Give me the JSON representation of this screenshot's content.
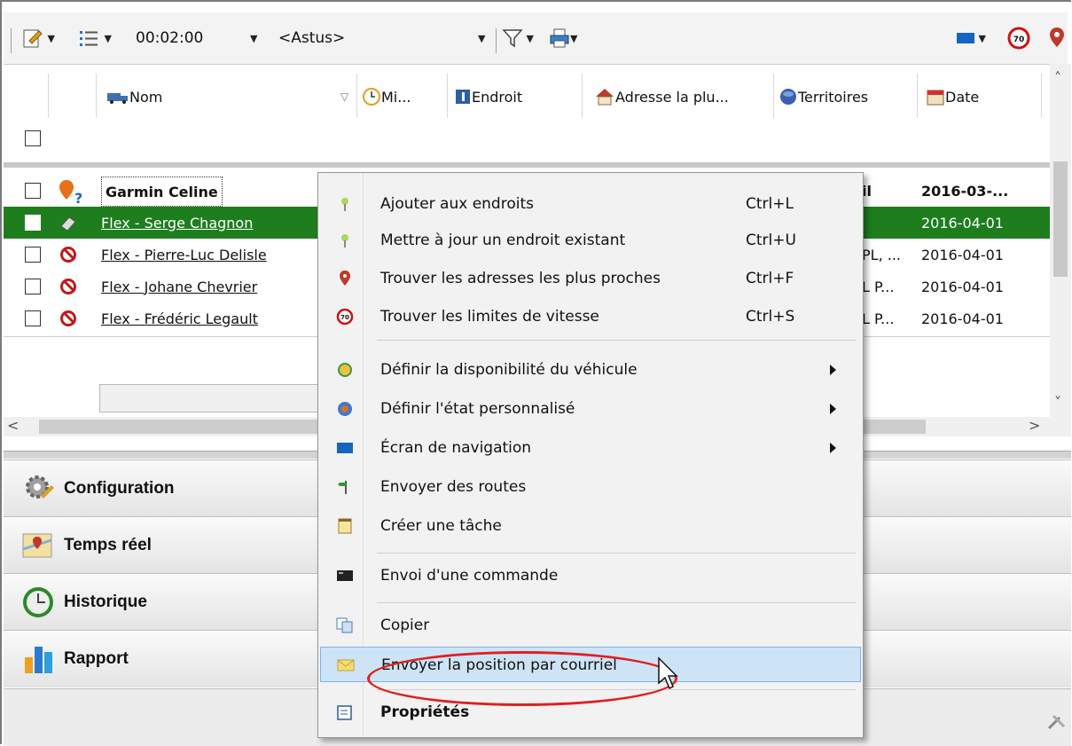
{
  "toolbar": {
    "interval": "00:02:00",
    "view_select": "<Astus>",
    "colors": {
      "bg": "#f3f3f3"
    }
  },
  "grid": {
    "columns": [
      "Nom",
      "Mi...",
      "Endroit",
      "Adresse la plu...",
      "Territoires",
      "Date"
    ],
    "rows": [
      {
        "name": "Garmin Celine",
        "address_cut": "il",
        "date": "2016-03-..."
      },
      {
        "name": "Flex - Serge Chagnon",
        "address_cut": "",
        "date": "2016-04-01"
      },
      {
        "name": "Flex - Pierre-Luc Delisle",
        "address_cut": "PL, ...",
        "date": "2016-04-01"
      },
      {
        "name": "Flex - Johane Chevrier",
        "address_cut": "L P...",
        "date": "2016-04-01"
      },
      {
        "name": "Flex - Frédéric Legault",
        "address_cut": "L P...",
        "date": "2016-04-01"
      }
    ],
    "selected_color": "#1e7e1e"
  },
  "nav": {
    "items": [
      "Configuration",
      "Temps réel",
      "Historique",
      "Rapport"
    ]
  },
  "menu": {
    "items": [
      {
        "label": "Ajouter aux endroits",
        "shortcut": "Ctrl+L",
        "icon": "pin-icon"
      },
      {
        "label": "Mettre à jour un endroit existant",
        "shortcut": "Ctrl+U",
        "icon": "pin-icon"
      },
      {
        "label": "Trouver les adresses les plus proches",
        "shortcut": "Ctrl+F",
        "icon": "map-marker-icon"
      },
      {
        "label": "Trouver les limites de vitesse",
        "shortcut": "Ctrl+S",
        "icon": "speed-limit-icon"
      },
      {
        "label": "Définir la disponibilité du véhicule",
        "shortcut": "",
        "icon": "availability-icon"
      },
      {
        "label": "Définir l'état personnalisé",
        "shortcut": "",
        "icon": "custom-state-icon"
      },
      {
        "label": "Écran de navigation",
        "shortcut": "",
        "icon": "screen-icon"
      },
      {
        "label": "Envoyer des routes",
        "shortcut": "",
        "icon": "route-icon"
      },
      {
        "label": "Créer une tâche",
        "shortcut": "",
        "icon": "task-icon"
      },
      {
        "label": "Envoi d'une commande",
        "shortcut": "",
        "icon": "command-icon"
      },
      {
        "label": "Copier",
        "shortcut": "",
        "icon": "copy-icon"
      },
      {
        "label": "Envoyer la position par courriel",
        "shortcut": "",
        "icon": "email-icon"
      },
      {
        "label": "Propriétés",
        "shortcut": "",
        "icon": "properties-icon"
      }
    ],
    "highlight_color": "#cde4f7",
    "annotation_color": "#e02020"
  },
  "speed_badge": "70"
}
